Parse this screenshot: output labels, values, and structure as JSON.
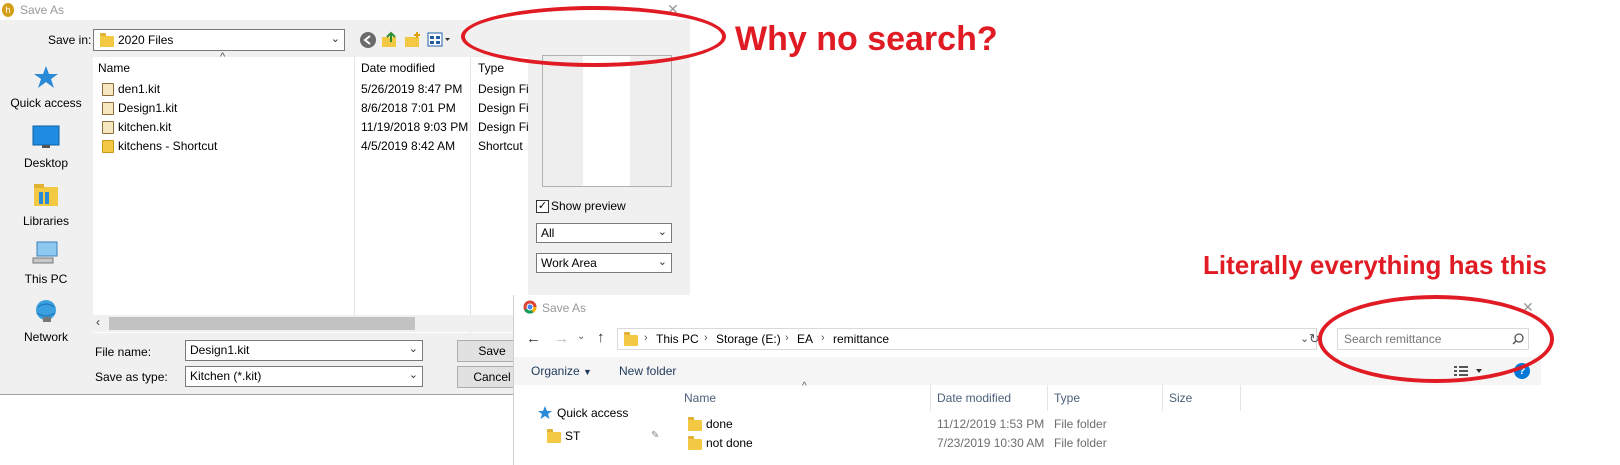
{
  "dialog1": {
    "title": "Save As",
    "save_in_label": "Save in:",
    "save_in_value": "2020 Files",
    "places": [
      "Quick access",
      "Desktop",
      "Libraries",
      "This PC",
      "Network"
    ],
    "columns": {
      "name": "Name",
      "date": "Date modified",
      "type": "Type"
    },
    "files": [
      {
        "name": "den1.kit",
        "date": "5/26/2019 8:47 PM",
        "type": "Design Fil"
      },
      {
        "name": "Design1.kit",
        "date": "8/6/2018 7:01 PM",
        "type": "Design Fil"
      },
      {
        "name": "kitchen.kit",
        "date": "11/19/2018 9:03 PM",
        "type": "Design Fil"
      },
      {
        "name": "kitchens - Shortcut",
        "date": "4/5/2019 8:42 AM",
        "type": "Shortcut"
      }
    ],
    "show_preview_label": "Show preview",
    "filter1": "All",
    "filter2": "Work Area",
    "file_name_label": "File name:",
    "file_name_value": "Design1.kit",
    "save_type_label": "Save as type:",
    "save_type_value": "Kitchen (*.kit)",
    "save_button": "Save",
    "cancel_button": "Cancel"
  },
  "dialog2": {
    "title": "Save As",
    "breadcrumbs": [
      "This PC",
      "Storage (E:)",
      "EA",
      "remittance"
    ],
    "search_placeholder": "Search remittance",
    "organize_label": "Organize",
    "new_folder_label": "New folder",
    "nav": {
      "quick_access": "Quick access",
      "st": "ST"
    },
    "columns": {
      "name": "Name",
      "date": "Date modified",
      "type": "Type",
      "size": "Size"
    },
    "files": [
      {
        "name": "done",
        "date": "11/12/2019 1:53 PM",
        "type": "File folder"
      },
      {
        "name": "not done",
        "date": "7/23/2019 10:30 AM",
        "type": "File folder"
      }
    ]
  },
  "annotations": {
    "top": "Why no search?",
    "bottom": "Literally everything has this"
  },
  "colors": {
    "annotation": "#e01b24",
    "folder": "#f3c843",
    "accent": "#0078d7"
  },
  "icons": [
    "quick-access-star-icon",
    "desktop-icon",
    "libraries-icon",
    "this-pc-icon",
    "network-icon",
    "back-icon",
    "up-folder-icon",
    "new-folder-icon",
    "view-menu-icon",
    "search-icon",
    "help-icon",
    "refresh-icon",
    "pin-icon"
  ]
}
